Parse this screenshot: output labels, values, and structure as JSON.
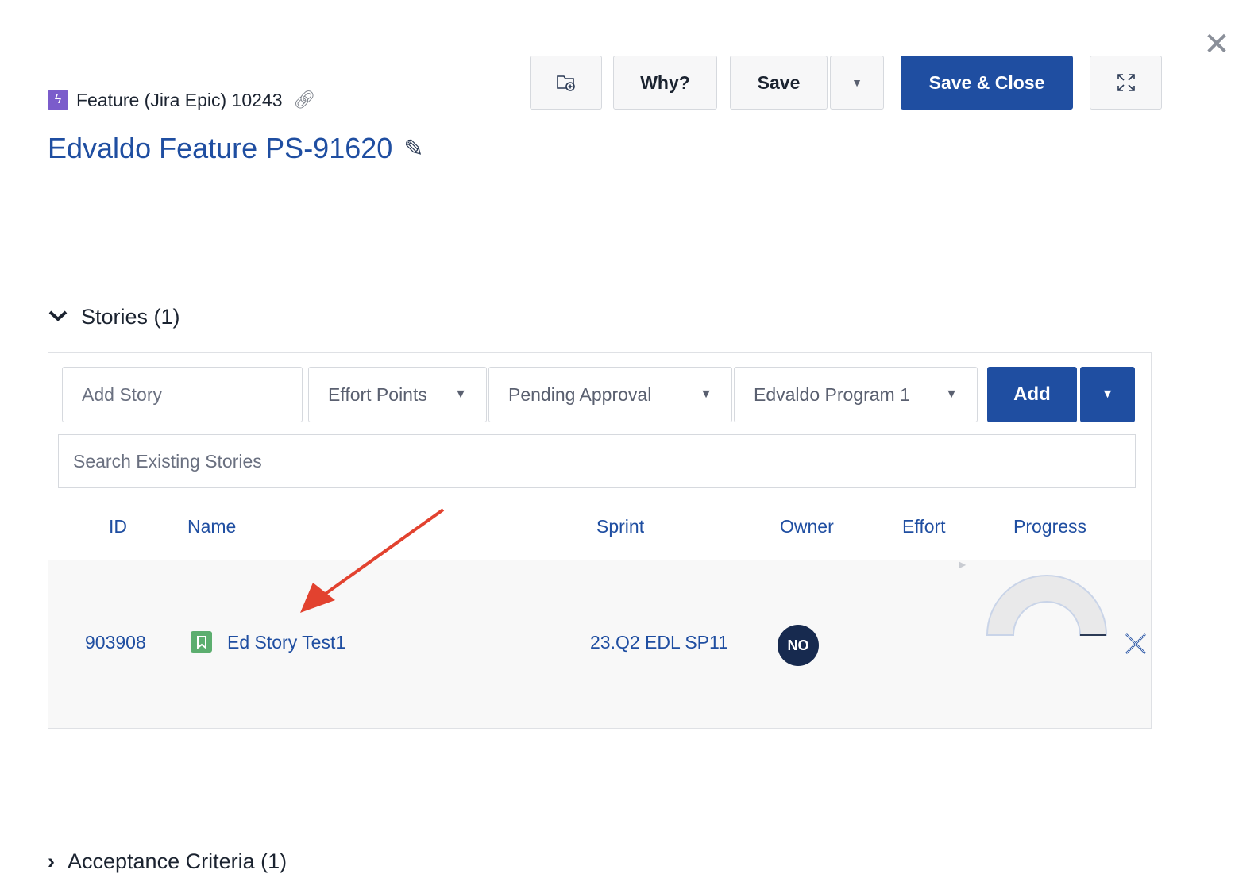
{
  "header": {
    "type_label": "Feature (Jira Epic) 10243",
    "title": "Edvaldo Feature PS-91620"
  },
  "toolbar": {
    "why_label": "Why?",
    "save_label": "Save",
    "save_close_label": "Save & Close"
  },
  "stories": {
    "section_title": "Stories (1)",
    "add_story_placeholder": "Add Story",
    "effort_select": "Effort Points",
    "status_select": "Pending Approval",
    "program_select": "Edvaldo Program 1",
    "add_label": "Add",
    "search_placeholder": "Search Existing Stories",
    "columns": [
      "ID",
      "Name",
      "Sprint",
      "Owner",
      "Effort",
      "Progress"
    ],
    "rows": [
      {
        "id": "903908",
        "name": "Ed Story Test1",
        "sprint": "23.Q2 EDL SP11",
        "owner_initials": "NO",
        "effort": ""
      }
    ]
  },
  "next_section_title": "Acceptance Criteria (1)",
  "colors": {
    "primary": "#1f4ea1",
    "feature_icon": "#7b5ccb",
    "story_icon": "#5cae6f",
    "avatar": "#172a4f",
    "annotation_arrow": "#e2422f"
  },
  "icons": [
    "close-icon",
    "feature-icon",
    "link-icon",
    "pencil-icon",
    "add-folder-icon",
    "chevron-down-icon",
    "expand-icon",
    "story-icon",
    "remove-icon"
  ]
}
